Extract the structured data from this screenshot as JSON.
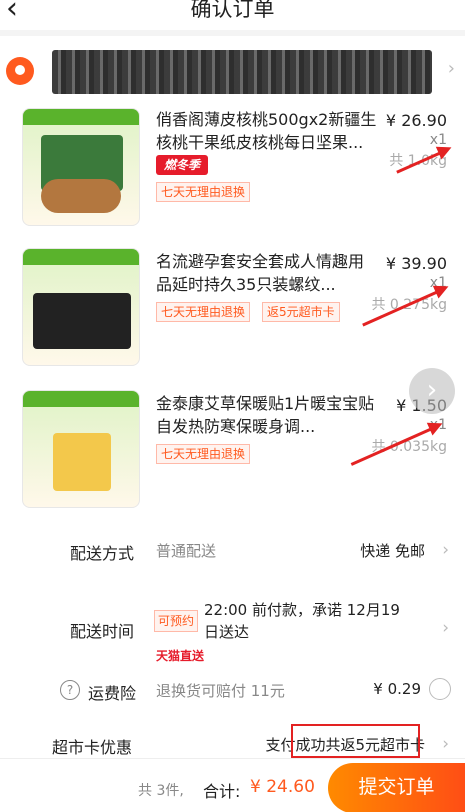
{
  "header": {
    "back_icon": "‹",
    "title": "确认订单"
  },
  "items": [
    {
      "name": "俏香阁薄皮核桃500gx2新疆生核桃干果纸皮核桃每日坚果...",
      "price": "¥ 26.90",
      "qty": "x1",
      "weight": "共 1.0kg",
      "promo_tag": "燃冬季",
      "service_tag": "七天无理由退换"
    },
    {
      "name": "名流避孕套安全套成人情趣用品延时持久35只装螺纹...",
      "price": "¥ 39.90",
      "qty": "x1",
      "weight": "共 0.275kg",
      "service_tag": "七天无理由退换",
      "card_tag": "返5元超市卡"
    },
    {
      "name": "金泰康艾草保暖贴1片暖宝宝贴自发热防寒保暖身调...",
      "price": "¥ 1.50",
      "qty": "x1",
      "weight": "共 0.035kg",
      "service_tag": "七天无理由退换"
    }
  ],
  "delivery": {
    "label": "配送方式",
    "option": "普通配送",
    "value": "快递 免邮"
  },
  "time": {
    "label": "配送时间",
    "reserve_badge": "可预约",
    "text": "22:00 前付款，承诺 12月19日送达",
    "tmall_tag": "天猫直送"
  },
  "insurance": {
    "label": "运费险",
    "desc": "退换货可赔付 11元",
    "value": "¥ 0.29"
  },
  "supercard": {
    "label": "超市卡优惠",
    "value": "支付成功共返5元超市卡"
  },
  "footer": {
    "count": "共 3件,",
    "total_label": "合计:",
    "total": "¥ 24.60",
    "submit": "提交订单"
  },
  "colors": {
    "accent": "#ff5a1f",
    "winter_red": "#e61c2b",
    "annotation_red": "#e32222",
    "submit_gradient_start": "#ff8a00"
  }
}
